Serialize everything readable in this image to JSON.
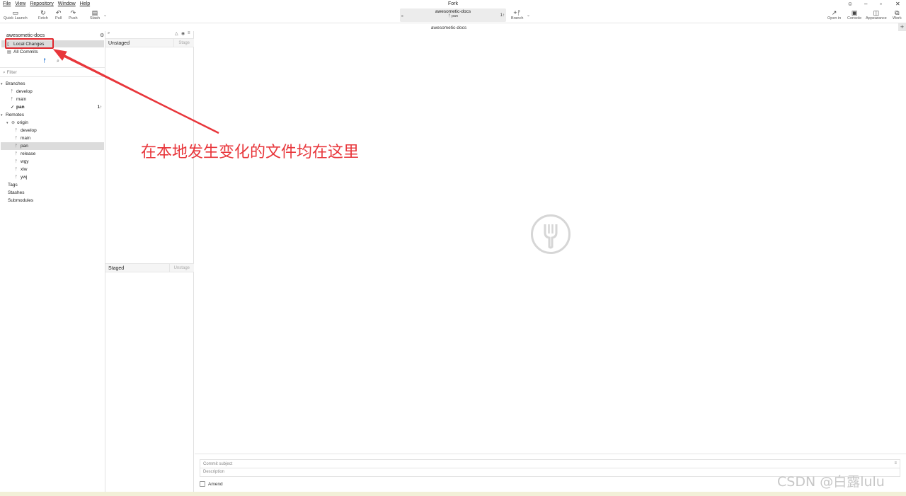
{
  "menu": [
    "File",
    "View",
    "Repository",
    "Window",
    "Help"
  ],
  "app_title": "Fork",
  "toolbar": {
    "quick_launch": "Quick Launch",
    "fetch": "Fetch",
    "pull": "Pull",
    "push": "Push",
    "stash": "Stash",
    "repo_name": "awesometic-docs",
    "branch_name": "pan",
    "branch_btn": "Branch",
    "open_in": "Open in",
    "console": "Console",
    "appearance": "Appearance",
    "work": "Work"
  },
  "sidebar": {
    "repo_name": "awesometic-docs",
    "local_changes": "Local Changes",
    "all_commits": "All Commits",
    "filter_placeholder": "Filter",
    "branches_label": "Branches",
    "branches": [
      "develop",
      "main",
      "pan"
    ],
    "current_branch_badge": "1↑",
    "remotes_label": "Remotes",
    "remote_name": "origin",
    "remote_branches": [
      "develop",
      "main",
      "pan",
      "release",
      "wgy",
      "xlw",
      "ywj"
    ],
    "tags_label": "Tags",
    "stashes_label": "Stashes",
    "submodules_label": "Submodules"
  },
  "changes": {
    "unstaged_label": "Unstaged",
    "stage_btn": "Stage",
    "staged_label": "Staged",
    "unstage_btn": "Unstage"
  },
  "main": {
    "title": "awesometic-docs",
    "commit_subject_placeholder": "Commit subject",
    "description_placeholder": "Description",
    "amend_label": "Amend"
  },
  "annotation": {
    "text": "在本地发生变化的文件均在这里",
    "color": "#e8363b"
  },
  "watermark": "CSDN @白露lulu"
}
